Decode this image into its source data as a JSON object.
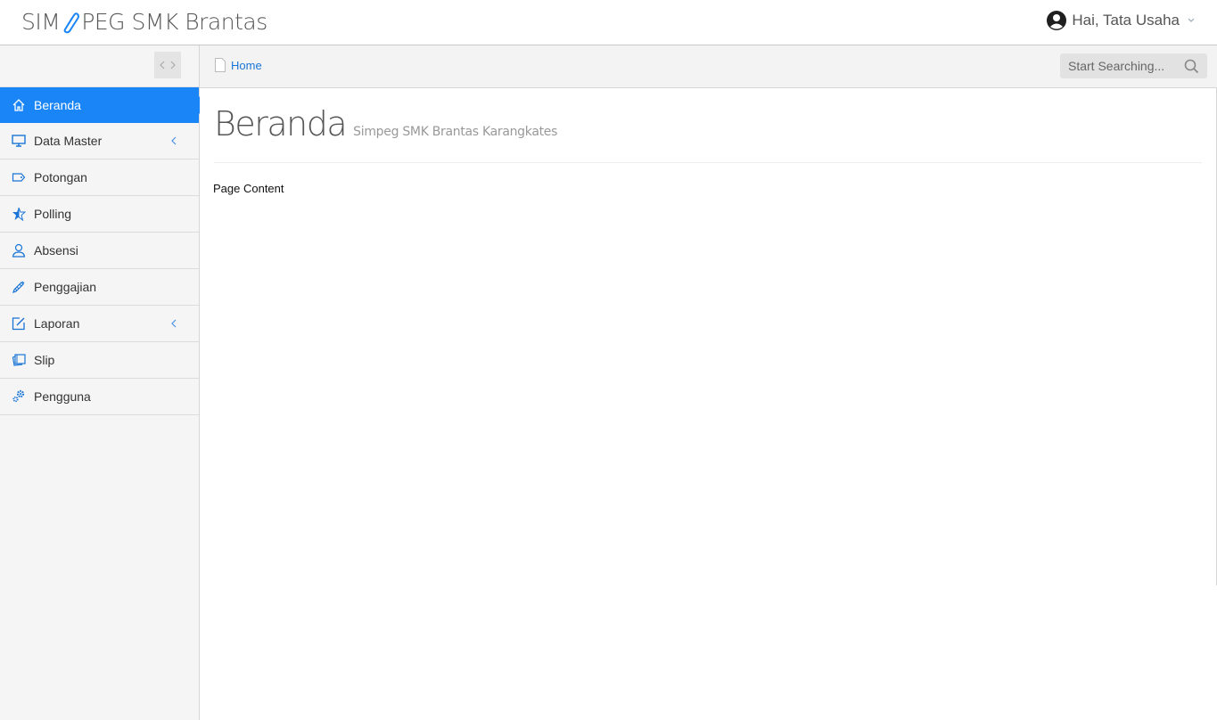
{
  "header": {
    "brand_prefix": "SIM",
    "brand_suffix": "PEG SMK Brantas",
    "user_greeting": "Hai, Tata Usaha"
  },
  "sidebar": {
    "items": [
      {
        "label": "Beranda",
        "icon": "home-icon",
        "active": true
      },
      {
        "label": "Data Master",
        "icon": "monitor-icon",
        "has_submenu": true
      },
      {
        "label": "Potongan",
        "icon": "tag-icon"
      },
      {
        "label": "Polling",
        "icon": "star-icon"
      },
      {
        "label": "Absensi",
        "icon": "user-icon"
      },
      {
        "label": "Penggajian",
        "icon": "pen-icon"
      },
      {
        "label": "Laporan",
        "icon": "edit-icon",
        "has_submenu": true
      },
      {
        "label": "Slip",
        "icon": "notes-icon"
      },
      {
        "label": "Pengguna",
        "icon": "gears-icon"
      }
    ]
  },
  "breadcrumb": {
    "home_label": "Home"
  },
  "search": {
    "placeholder": "Start Searching..."
  },
  "main": {
    "title": "Beranda",
    "subtitle": "Simpeg SMK Brantas Karangkates",
    "body": "Page Content"
  },
  "colors": {
    "accent": "#1a85f6",
    "sidebar_bg": "#f5f5f5"
  }
}
